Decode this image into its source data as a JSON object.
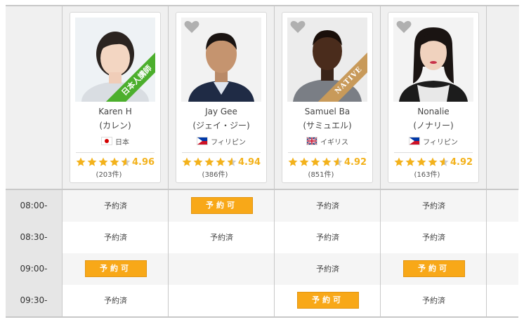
{
  "tutors": [
    {
      "name": "Karen H",
      "kana": "(カレン)",
      "country": "日本",
      "flag": "jp",
      "rating": "4.96",
      "reviews": "(203件)",
      "badge": "日本人講師",
      "stars": 4.5
    },
    {
      "name": "Jay Gee",
      "kana": "(ジェイ・ジー)",
      "country": "フィリピン",
      "flag": "ph",
      "rating": "4.94",
      "reviews": "(386件)",
      "badge": "",
      "stars": 4.5
    },
    {
      "name": "Samuel Ba",
      "kana": "(サミュエル)",
      "country": "イギリス",
      "flag": "uk",
      "rating": "4.92",
      "reviews": "(851件)",
      "badge": "NATIVE",
      "stars": 4.5
    },
    {
      "name": "Nonalie",
      "kana": "(ノナリー)",
      "country": "フィリピン",
      "flag": "ph",
      "rating": "4.92",
      "reviews": "(163件)",
      "badge": "",
      "stars": 4.5
    }
  ],
  "times": [
    "08:00-",
    "08:30-",
    "09:00-",
    "09:30-"
  ],
  "labels": {
    "booked": "予約済",
    "available": "予約可"
  },
  "schedule": [
    [
      "booked",
      "available",
      "booked",
      "booked"
    ],
    [
      "booked",
      "booked",
      "booked",
      "booked"
    ],
    [
      "available",
      "",
      "booked",
      "available"
    ],
    [
      "booked",
      "",
      "available",
      "booked"
    ]
  ],
  "colors": {
    "accent": "#f8a818",
    "star": "#f3b21c",
    "native_badge": "#c89a5a",
    "jp_badge": "#4caf2d"
  }
}
